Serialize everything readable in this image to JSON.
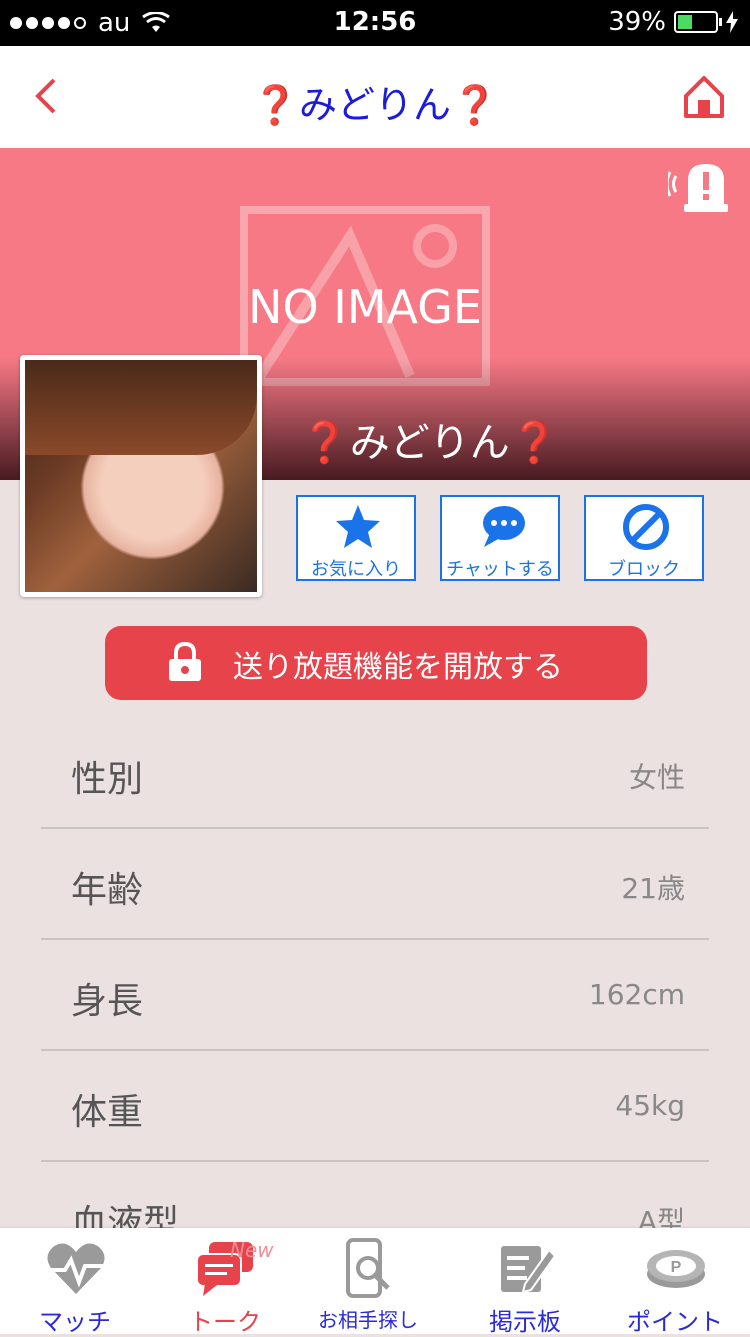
{
  "status": {
    "carrier": "au",
    "time": "12:56",
    "battery": "39%",
    "battery_level": 0.39
  },
  "nav": {
    "title": "❓みどりん❓"
  },
  "cover": {
    "placeholder": "NO IMAGE",
    "name": "❓みどりん❓"
  },
  "actions": [
    {
      "label": "お気に入り",
      "icon": "star-icon"
    },
    {
      "label": "チャットする",
      "icon": "chat-bubble-icon"
    },
    {
      "label": "ブロック",
      "icon": "block-icon"
    }
  ],
  "unlock": {
    "label": "送り放題機能を開放する"
  },
  "profile": [
    {
      "key": "性別",
      "value": "女性"
    },
    {
      "key": "年齢",
      "value": "21歳"
    },
    {
      "key": "身長",
      "value": "162cm"
    },
    {
      "key": "体重",
      "value": "45kg"
    },
    {
      "key": "血液型",
      "value": "A型"
    }
  ],
  "tabs": [
    {
      "label": "マッチ",
      "icon": "heartbeat-icon"
    },
    {
      "label": "トーク",
      "icon": "chat-icon",
      "badge": "New"
    },
    {
      "label": "お相手探し",
      "icon": "phone-search-icon"
    },
    {
      "label": "掲示板",
      "icon": "board-icon"
    },
    {
      "label": "ポイント",
      "icon": "point-coin-icon"
    }
  ],
  "colors": {
    "accent_red": "#e6434b",
    "blue": "#1a73e8",
    "cover_pink": "#f67985",
    "title_blue": "#1b1bd8"
  }
}
